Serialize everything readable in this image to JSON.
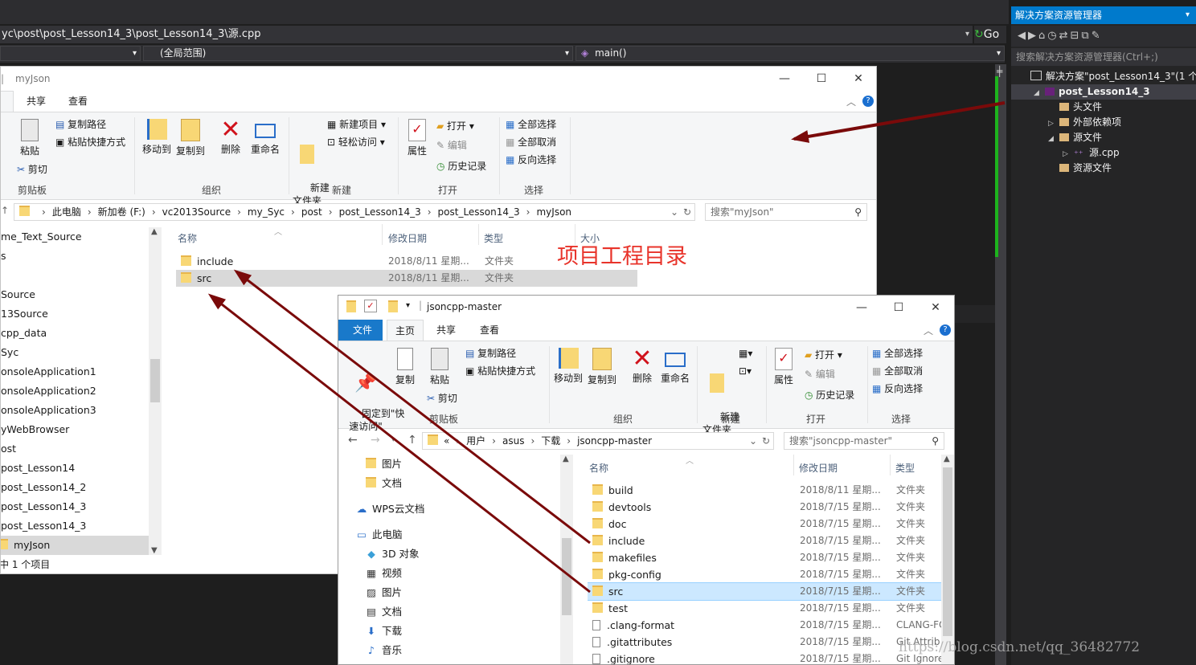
{
  "vs": {
    "path": "yc\\post\\post_Lesson14_3\\post_Lesson14_3\\源.cpp",
    "go": "Go",
    "scope": "(全局范围)",
    "function": "main()"
  },
  "solution_explorer": {
    "title": "解决方案资源管理器",
    "search_placeholder": "搜索解决方案资源管理器(Ctrl+;)",
    "tree": [
      {
        "label": "解决方案\"post_Lesson14_3\"(1 个项目",
        "indent": 0,
        "arrow": ""
      },
      {
        "label": "post_Lesson14_3",
        "indent": 1,
        "arrow": "◢",
        "selected": true
      },
      {
        "label": "头文件",
        "indent": 2,
        "arrow": ""
      },
      {
        "label": "外部依赖项",
        "indent": 2,
        "arrow": "▷"
      },
      {
        "label": "源文件",
        "indent": 2,
        "arrow": "◢"
      },
      {
        "label": "源.cpp",
        "indent": 3,
        "arrow": "▷"
      },
      {
        "label": "资源文件",
        "indent": 2,
        "arrow": ""
      }
    ]
  },
  "win1": {
    "title": "myJson",
    "tabs": [
      "共享",
      "查看"
    ],
    "ribbon": {
      "paste": "粘贴",
      "copy_path": "复制路径",
      "paste_shortcut": "粘贴快捷方式",
      "cut": "剪切",
      "clipboard": "剪贴板",
      "move_to": "移动到",
      "copy_to": "复制到",
      "delete": "删除",
      "rename": "重命名",
      "organize": "组织",
      "new_folder": "新建\n文件夹",
      "new_item": "新建项目",
      "easy_access": "轻松访问",
      "new": "新建",
      "properties": "属性",
      "open": "打开",
      "edit": "编辑",
      "history": "历史记录",
      "open_group": "打开",
      "select_all": "全部选择",
      "select_none": "全部取消",
      "invert": "反向选择",
      "select": "选择"
    },
    "breadcrumb": [
      "此电脑",
      "新加卷 (F:)",
      "vc2013Source",
      "my_Syc",
      "post",
      "post_Lesson14_3",
      "post_Lesson14_3",
      "myJson"
    ],
    "search": "搜索\"myJson\"",
    "columns": {
      "name": "名称",
      "date": "修改日期",
      "type": "类型",
      "size": "大小"
    },
    "files": [
      {
        "name": "include",
        "date": "2018/8/11 星期...",
        "type": "文件夹"
      },
      {
        "name": "src",
        "date": "2018/8/11 星期...",
        "type": "文件夹"
      }
    ],
    "nav": [
      "me_Text_Source",
      "s",
      "",
      "Source",
      "13Source",
      "cpp_data",
      "Syc",
      "onsoleApplication1",
      "onsoleApplication2",
      "onsoleApplication3",
      "yWebBrowser",
      "ost",
      "post_Lesson14",
      "post_Lesson14_2",
      "post_Lesson14_3",
      "post_Lesson14_3",
      "myJson"
    ],
    "status": "中 1 个项目",
    "annotation": "项目工程目录"
  },
  "win2": {
    "title": "jsoncpp-master",
    "tabs": [
      "文件",
      "主页",
      "共享",
      "查看"
    ],
    "ribbon": {
      "pin": "固定到\"快\n速访问\"",
      "copy": "复制",
      "paste": "粘贴",
      "copy_path": "复制路径",
      "paste_shortcut": "粘贴快捷方式",
      "cut": "剪切",
      "clipboard": "剪贴板",
      "move_to": "移动到",
      "copy_to": "复制到",
      "delete": "删除",
      "rename": "重命名",
      "organize": "组织",
      "new_folder": "新建\n文件夹",
      "new": "新建",
      "properties": "属性",
      "open": "打开",
      "edit": "编辑",
      "history": "历史记录",
      "open_group": "打开",
      "select_all": "全部选择",
      "select_none": "全部取消",
      "invert": "反向选择",
      "select": "选择"
    },
    "breadcrumb": [
      "«",
      "用户",
      "asus",
      "下载",
      "jsoncpp-master"
    ],
    "search": "搜索\"jsoncpp-master\"",
    "columns": {
      "name": "名称",
      "date": "修改日期",
      "type": "类型"
    },
    "files": [
      {
        "name": "build",
        "date": "2018/8/11 星期...",
        "type": "文件夹",
        "kind": "folder"
      },
      {
        "name": "devtools",
        "date": "2018/7/15 星期...",
        "type": "文件夹",
        "kind": "folder"
      },
      {
        "name": "doc",
        "date": "2018/7/15 星期...",
        "type": "文件夹",
        "kind": "folder"
      },
      {
        "name": "include",
        "date": "2018/7/15 星期...",
        "type": "文件夹",
        "kind": "folder"
      },
      {
        "name": "makefiles",
        "date": "2018/7/15 星期...",
        "type": "文件夹",
        "kind": "folder"
      },
      {
        "name": "pkg-config",
        "date": "2018/7/15 星期...",
        "type": "文件夹",
        "kind": "folder"
      },
      {
        "name": "src",
        "date": "2018/7/15 星期...",
        "type": "文件夹",
        "kind": "folder"
      },
      {
        "name": "test",
        "date": "2018/7/15 星期...",
        "type": "文件夹",
        "kind": "folder"
      },
      {
        "name": ".clang-format",
        "date": "2018/7/15 星期...",
        "type": "CLANG-FO",
        "kind": "file"
      },
      {
        "name": ".gitattributes",
        "date": "2018/7/15 星期...",
        "type": "Git Attrib",
        "kind": "file"
      },
      {
        "name": ".gitignore",
        "date": "2018/7/15 星期...",
        "type": "Git Ignore",
        "kind": "file"
      }
    ],
    "nav": [
      {
        "label": "图片",
        "icon": "folder-icon"
      },
      {
        "label": "文档",
        "icon": "folder-icon"
      },
      {
        "label": "WPS云文档",
        "icon": "cloud-icon"
      },
      {
        "label": "此电脑",
        "icon": "pc-icon"
      },
      {
        "label": "3D 对象",
        "icon": "cube-icon"
      },
      {
        "label": "视频",
        "icon": "video-icon"
      },
      {
        "label": "图片",
        "icon": "picture-icon"
      },
      {
        "label": "文档",
        "icon": "document-icon"
      },
      {
        "label": "下载",
        "icon": "download-icon"
      },
      {
        "label": "音乐",
        "icon": "music-icon"
      }
    ]
  },
  "watermark": "https://blog.csdn.net/qq_36482772",
  "colors": {
    "arrow": "#7a0a0a",
    "annotation": "#e8332a",
    "vs_accent": "#007acc"
  }
}
